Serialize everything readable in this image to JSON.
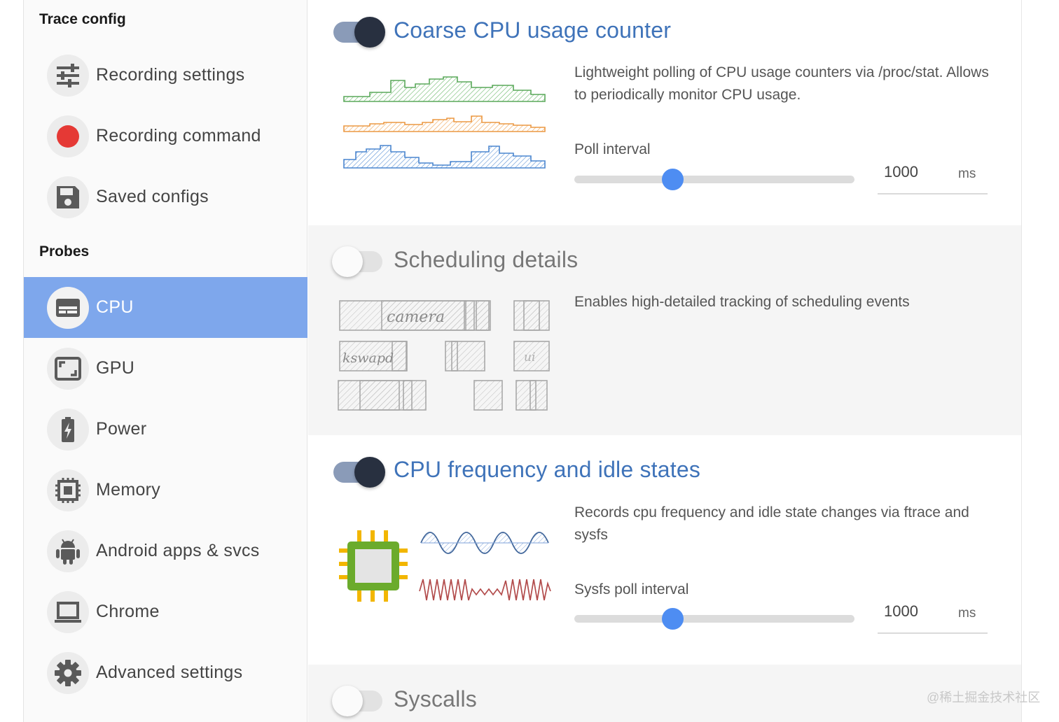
{
  "sidebar": {
    "trace_config_title": "Trace config",
    "trace_items": [
      {
        "label": "Recording settings",
        "icon": "tune-icon"
      },
      {
        "label": "Recording command",
        "icon": "record-dot-icon"
      },
      {
        "label": "Saved configs",
        "icon": "save-icon"
      }
    ],
    "probes_title": "Probes",
    "probe_items": [
      {
        "label": "CPU",
        "icon": "cpu-panel-icon",
        "active": true
      },
      {
        "label": "GPU",
        "icon": "gpu-icon"
      },
      {
        "label": "Power",
        "icon": "battery-charging-icon"
      },
      {
        "label": "Memory",
        "icon": "memory-chip-icon"
      },
      {
        "label": "Android apps & svcs",
        "icon": "android-icon"
      },
      {
        "label": "Chrome",
        "icon": "laptop-icon"
      },
      {
        "label": "Advanced settings",
        "icon": "gear-icon"
      }
    ]
  },
  "probes": {
    "coarse_cpu": {
      "enabled": true,
      "title": "Coarse CPU usage counter",
      "description": "Lightweight polling of CPU usage counters via /proc/stat. Allows to periodically monitor CPU usage.",
      "field_label": "Poll interval",
      "value": "1000",
      "unit": "ms",
      "slider_fraction": 0.35
    },
    "scheduling": {
      "enabled": false,
      "title": "Scheduling details",
      "description": "Enables high-detailed tracking of scheduling events",
      "sketch_labels": [
        "camera",
        "kswapd",
        "ui"
      ]
    },
    "cpu_freq": {
      "enabled": true,
      "title": "CPU frequency and idle states",
      "description": "Records cpu frequency and idle state changes via ftrace and sysfs",
      "field_label": "Sysfs poll interval",
      "value": "1000",
      "unit": "ms",
      "slider_fraction": 0.35
    },
    "syscalls": {
      "enabled": false,
      "title": "Syscalls"
    }
  },
  "watermark": "@稀土掘金技术社区",
  "colors": {
    "active_sidebar": "#7ea7ec",
    "probe_title": "#3f73b9",
    "slider_thumb": "#4e8df2",
    "toggle_on_knob": "#283040",
    "record_dot": "#e53935"
  }
}
